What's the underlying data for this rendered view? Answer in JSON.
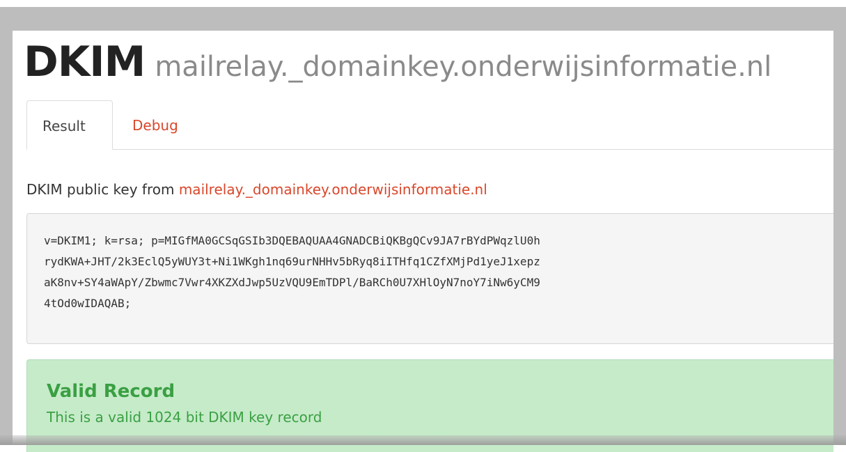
{
  "header": {
    "title": "DKIM",
    "domain": "mailrelay._domainkey.onderwijsinformatie.nl"
  },
  "tabs": [
    {
      "label": "Result",
      "active": true
    },
    {
      "label": "Debug",
      "active": false
    }
  ],
  "result": {
    "label_prefix": "DKIM public key from ",
    "label_link": "mailrelay._domainkey.onderwijsinformatie.nl",
    "record_lines": [
      "v=DKIM1; k=rsa; p=MIGfMA0GCSqGSIb3DQEBAQUAA4GNADCBiQKBgQCv9JA7rBYdPWqzlU0h",
      "rydKWA+JHT/2k3EclQ5yWUY3t+Ni1WKgh1nq69urNHHv5bRyq8iITHfq1CZfXMjPd1yeJ1xepz",
      "aK8nv+SY4aWApY/Zbwmc7Vwr4XKZXdJwp5UzVQU9EmTDPl/BaRCh0U7XHlOyN7noY7iNw6yCM9",
      "4tOd0wIDAQAB;"
    ]
  },
  "alert": {
    "title": "Valid Record",
    "message": "This is a valid 1024 bit DKIM key record"
  },
  "colors": {
    "accent": "#d9472b",
    "success_bg": "#c6ebc9",
    "success_text": "#3aa043"
  }
}
